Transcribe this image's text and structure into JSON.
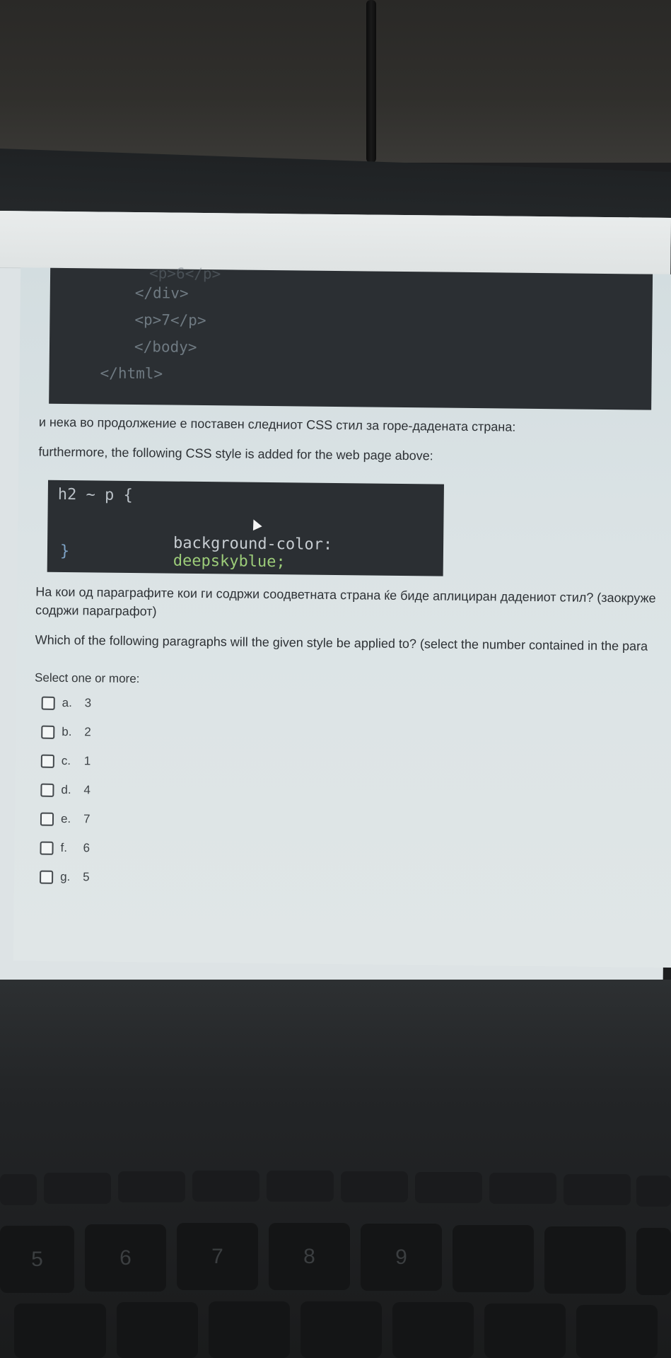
{
  "code_top": {
    "lines": [
      "<p>6</p>",
      "</div>",
      "<p>7</p>",
      "</body>",
      "</html>"
    ]
  },
  "question": {
    "intro_mk": "и нека во продолжение е поставен следниот CSS стил за горе-дадената страна:",
    "intro_en": "furthermore, the following CSS style is added for the web page above:",
    "q_mk_line1": "На кои од параграфите кои ги содржи соодветната страна ќе биде аплициран дадениот стил? (заокруже",
    "q_mk_line2": "содржи параграфот)",
    "q_en": "Which of the following paragraphs will the given style be applied to? (select the number contained in the para",
    "select_hint": "Select one or more:"
  },
  "css_code": {
    "selector_line": "h2 ~ p {",
    "property": "background-color:",
    "value": "deepskyblue;",
    "close": "}"
  },
  "options": [
    {
      "letter": "a.",
      "value": "3"
    },
    {
      "letter": "b.",
      "value": "2"
    },
    {
      "letter": "c.",
      "value": "1"
    },
    {
      "letter": "d.",
      "value": "4"
    },
    {
      "letter": "e.",
      "value": "7"
    },
    {
      "letter": "f.",
      "value": "6"
    },
    {
      "letter": "g.",
      "value": "5"
    }
  ],
  "keyboard": {
    "number_keys": [
      "5",
      "6",
      "7",
      "8",
      "9"
    ]
  }
}
